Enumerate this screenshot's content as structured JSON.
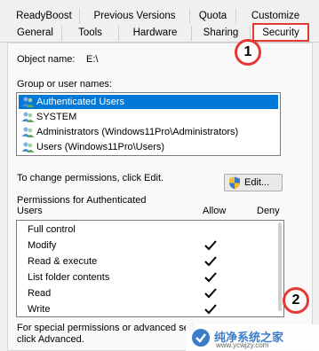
{
  "tabs_row1": [
    "ReadyBoost",
    "Previous Versions",
    "Quota",
    "Customize"
  ],
  "tabs_row2": [
    "General",
    "Tools",
    "Hardware",
    "Sharing",
    "Security"
  ],
  "active_tab": "Security",
  "object_name_label": "Object name:",
  "object_name_value": "E:\\",
  "group_label": "Group or user names:",
  "users": [
    {
      "name": "Authenticated Users",
      "selected": true
    },
    {
      "name": "SYSTEM",
      "selected": false
    },
    {
      "name": "Administrators (Windows11Pro\\Administrators)",
      "selected": false
    },
    {
      "name": "Users (Windows11Pro\\Users)",
      "selected": false
    }
  ],
  "change_perm_text": "To change permissions, click Edit.",
  "edit_button": "Edit...",
  "perm_label_1": "Permissions for Authenticated",
  "perm_label_2": "Users",
  "allow_header": "Allow",
  "deny_header": "Deny",
  "permissions": [
    {
      "name": "Full control",
      "allow": false
    },
    {
      "name": "Modify",
      "allow": true
    },
    {
      "name": "Read & execute",
      "allow": true
    },
    {
      "name": "List folder contents",
      "allow": true
    },
    {
      "name": "Read",
      "allow": true
    },
    {
      "name": "Write",
      "allow": true
    }
  ],
  "special_text_1": "For special permissions or advanced sett",
  "special_text_2": "click Advanced.",
  "callout_1": "1",
  "callout_2": "2",
  "watermark_text": "纯净系统之家",
  "watermark_url": "www.ycwjzy.com",
  "accent_color": "#e53935",
  "selection_color": "#0078d7"
}
